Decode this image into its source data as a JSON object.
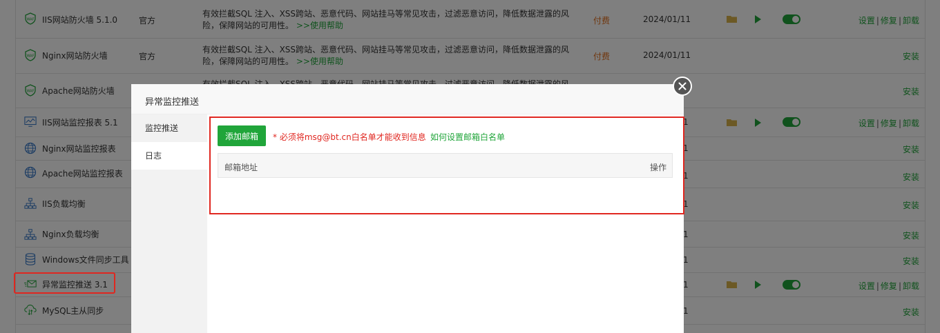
{
  "rows": [
    {
      "name": "IIS网站防火墙 5.1.0",
      "icon": "waf-icon",
      "dev": "官方",
      "desc": "有效拦截SQL 注入、XSS跨站、恶意代码、网站挂马等常见攻击，过滤恶意访问，降低数据泄露的风险，保障网站的可用性。",
      "help": ">>使用帮助",
      "price": "付费",
      "date": "2024/01/11",
      "ops": [
        "设置",
        "修复",
        "卸载"
      ]
    },
    {
      "name": "Nginx网站防火墙",
      "icon": "waf-icon",
      "dev": "官方",
      "desc": "有效拦截SQL 注入、XSS跨站、恶意代码、网站挂马等常见攻击，过滤恶意访问，降低数据泄露的风险，保障网站的可用性。",
      "help": ">>使用帮助",
      "price": "付费",
      "date": "2024/01/11",
      "install": "安装"
    },
    {
      "name": "Apache网站防火墙",
      "icon": "waf-icon",
      "desc": "有效拦截SQL 注入、XSS跨站、恶意代码、网站挂马等常见攻击，过滤恶意访问，降低数据泄露的风",
      "install": "安装"
    },
    {
      "name": "IIS网站监控报表 5.1",
      "icon": "monitor-chart-icon",
      "extra": "1",
      "ops": [
        "设置",
        "修复",
        "卸载"
      ]
    },
    {
      "name": "Nginx网站监控报表",
      "icon": "globe-icon",
      "extra": "1",
      "install": "安装"
    },
    {
      "name": "Apache网站监控报表",
      "icon": "globe-icon",
      "extra": "1",
      "install": "安装"
    },
    {
      "name": "IIS负载均衡",
      "icon": "network-icon",
      "extra": "1",
      "install": "安装"
    },
    {
      "name": "Nginx负载均衡",
      "icon": "network-icon",
      "extra": "1",
      "install": "安装"
    },
    {
      "name": "Windows文件同步工具",
      "icon": "database-icon",
      "extra": "1",
      "install": "安装"
    },
    {
      "name": "异常监控推送 3.1",
      "icon": "mail-send-icon",
      "extra": "1",
      "ops": [
        "设置",
        "修复",
        "卸载"
      ]
    },
    {
      "name": "MySQL主从同步",
      "icon": "cloud-sync-icon",
      "extra": "1",
      "install": "安装"
    }
  ],
  "modal": {
    "title": "异常监控推送",
    "side": [
      "监控推送",
      "日志"
    ],
    "add_button": "添加邮箱",
    "warning": "* 必须将msg@bt.cn白名单才能收到信息",
    "howto": "如何设置邮箱白名单",
    "col_email": "邮箱地址",
    "col_action": "操作",
    "close_icon": "close-icon"
  },
  "colors": {
    "accent": "#20a53a",
    "danger": "#e0261f",
    "price": "#e06d1b"
  }
}
